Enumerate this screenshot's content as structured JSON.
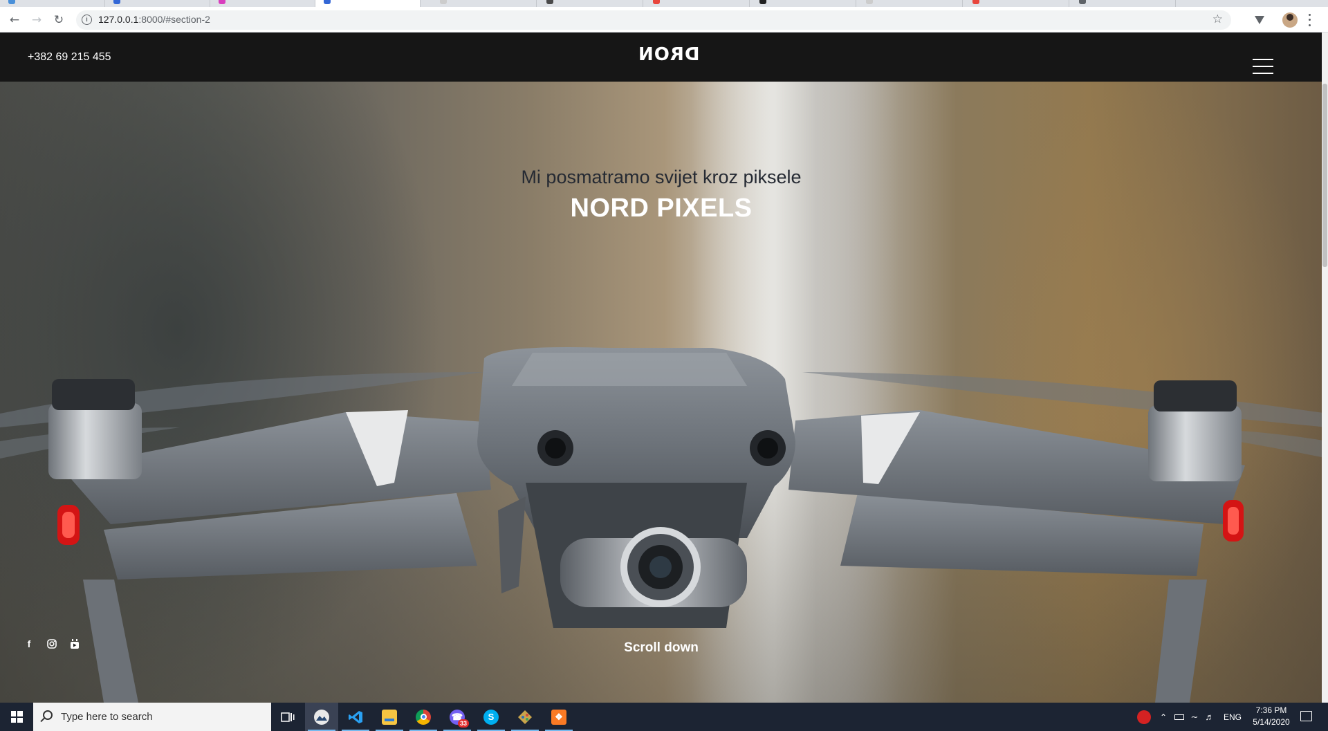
{
  "browser": {
    "url_host": "127.0.0.1",
    "url_path": ":8000/#section-2",
    "tab_favicon_colors": [
      "#4a90d9",
      "#3367d6",
      "#d93ebe",
      "#3367d6",
      "#cccccc",
      "#4a4a4a",
      "#e8453c",
      "#222222",
      "#cccccc",
      "#e8453c",
      "#5f6368"
    ]
  },
  "site": {
    "phone": "+382 69 215 455",
    "logo_text": "DRON",
    "subtitle": "Mi posmatramo svijet kroz piksele",
    "title": "NORD PIXELS",
    "scroll_label": "Scroll down",
    "social": [
      "facebook-icon",
      "instagram-icon",
      "youtube-icon"
    ]
  },
  "taskbar": {
    "search_placeholder": "Type here to search",
    "apps": [
      "task-view-icon",
      "photos-icon",
      "vscode-icon",
      "file-explorer-icon",
      "chrome-icon",
      "viber-icon",
      "skype-icon",
      "sourcetree-icon",
      "xampp-icon"
    ],
    "viber_badge": "33",
    "language": "ENG",
    "time": "7:36 PM",
    "date": "5/14/2020"
  }
}
